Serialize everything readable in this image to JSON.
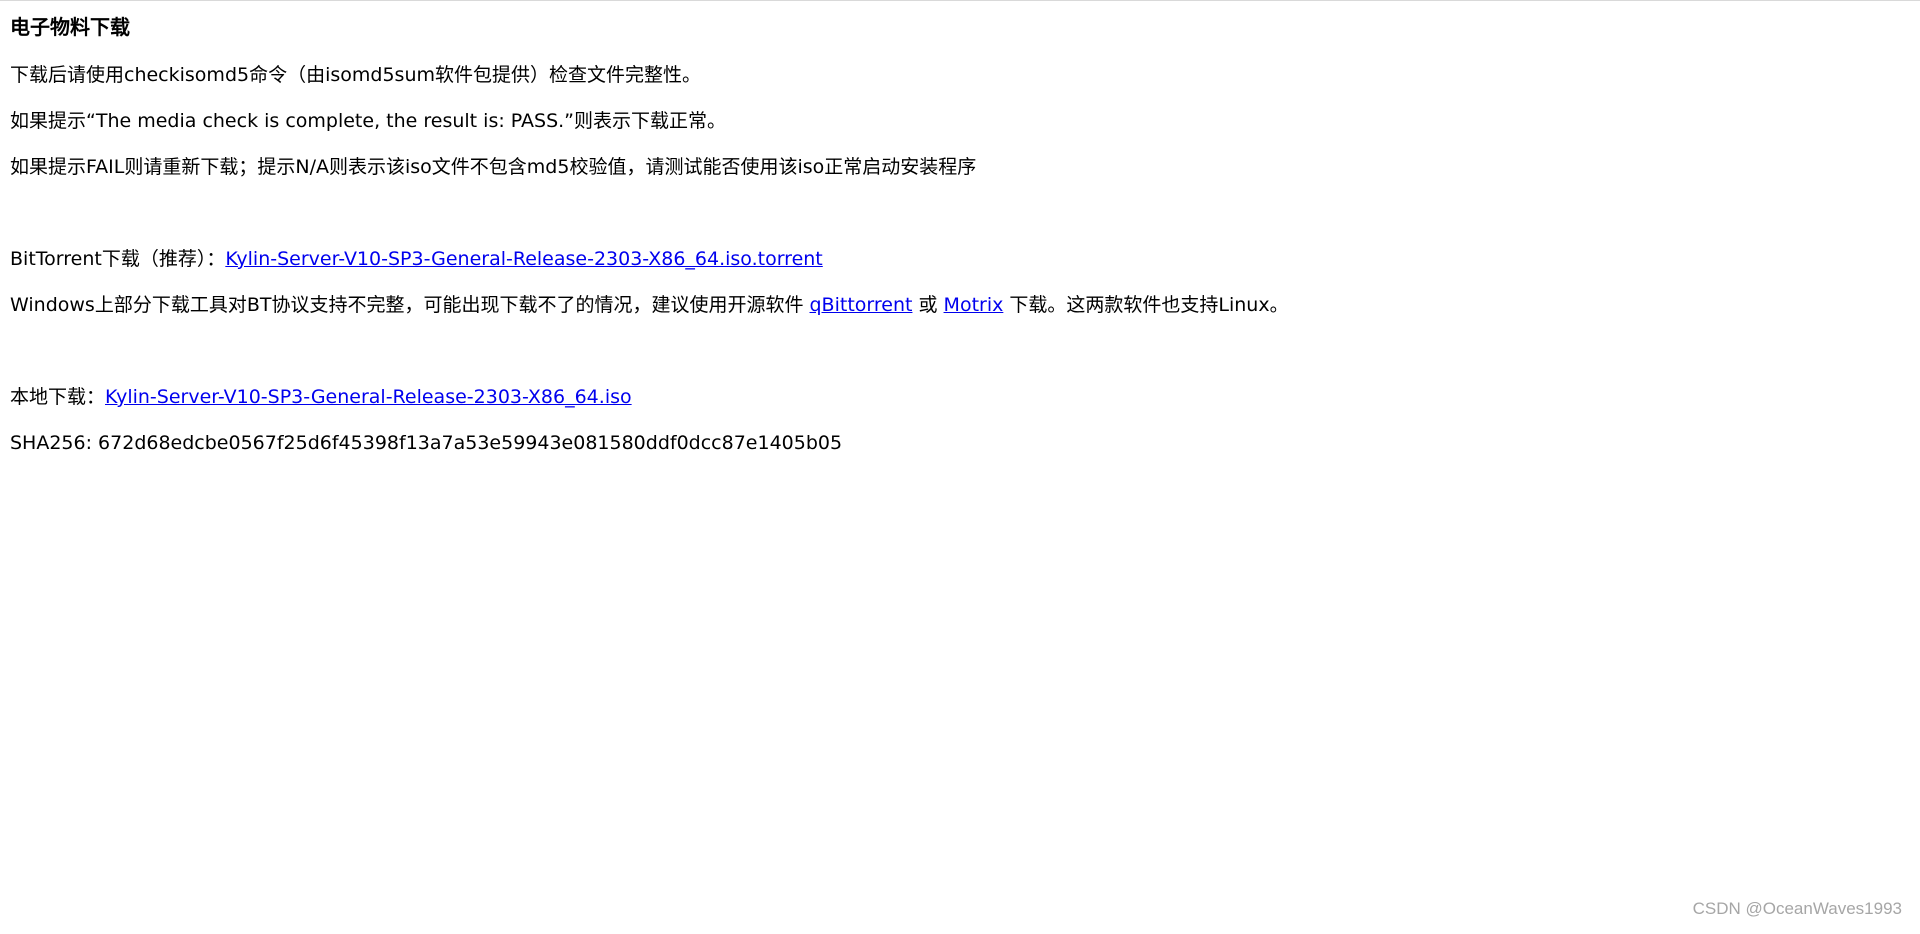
{
  "page": {
    "title": "电子物料下载",
    "intro": {
      "line1": "下载后请使用checkisomd5命令（由isomd5sum软件包提供）检查文件完整性。",
      "line2": "如果提示“The media check is complete, the result is: PASS.”则表示下载正常。",
      "line3": "如果提示FAIL则请重新下载；提示N/A则表示该iso文件不包含md5校验值，请测试能否使用该iso正常启动安装程序"
    },
    "bittorrent": {
      "label": "BitTorrent下载（推荐）：",
      "link_text": "Kylin-Server-V10-SP3-General-Release-2303-X86_64.iso.torrent",
      "note_before": "Windows上部分下载工具对BT协议支持不完整，可能出现下载不了的情况，建议使用开源软件 ",
      "qbittorrent_link": "qBittorrent",
      "note_or": " 或 ",
      "motrix_link": "Motrix",
      "note_after": " 下载。这两款软件也支持Linux。"
    },
    "local": {
      "label": "本地下载：",
      "link_text": "Kylin-Server-V10-SP3-General-Release-2303-X86_64.iso",
      "sha256": "SHA256: 672d68edcbe0567f25d6f45398f13a7a53e59943e081580ddf0dcc87e1405b05"
    }
  },
  "watermark": "CSDN @OceanWaves1993"
}
